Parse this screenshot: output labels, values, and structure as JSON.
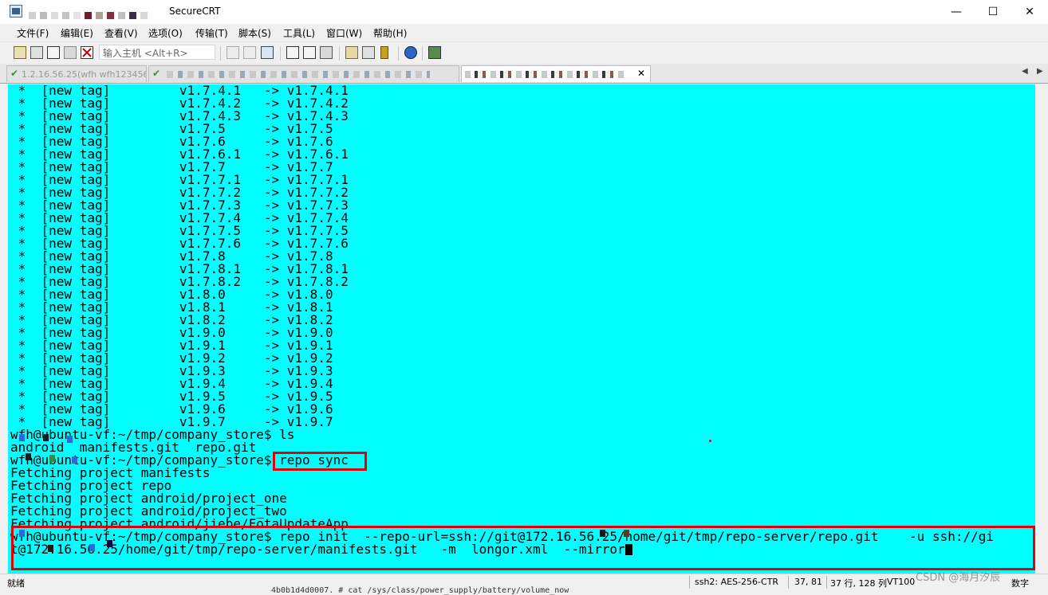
{
  "window": {
    "title": "SecureCRT",
    "minimize": "—",
    "maximize": "☐",
    "close": "✕"
  },
  "menu": [
    "文件(F)",
    "编辑(E)",
    "查看(V)",
    "选项(O)",
    "传输(T)",
    "脚本(S)",
    "工具(L)",
    "窗口(W)",
    "帮助(H)"
  ],
  "toolbar": {
    "host_placeholder": "输入主机 <Alt+R>"
  },
  "tabs": [
    {
      "label": "1.2.16.56.25(wfh wfh123456)",
      "active": false
    },
    {
      "label": "",
      "active": false
    },
    {
      "label": "",
      "active": true,
      "close": "✕"
    }
  ],
  "tab_scroll": {
    "left": "◀",
    "right": "▶"
  },
  "terminal": {
    "lines": [
      " *  [new tag]         v1.7.4.1   -> v1.7.4.1",
      " *  [new tag]         v1.7.4.2   -> v1.7.4.2",
      " *  [new tag]         v1.7.4.3   -> v1.7.4.3",
      " *  [new tag]         v1.7.5     -> v1.7.5",
      " *  [new tag]         v1.7.6     -> v1.7.6",
      " *  [new tag]         v1.7.6.1   -> v1.7.6.1",
      " *  [new tag]         v1.7.7     -> v1.7.7",
      " *  [new tag]         v1.7.7.1   -> v1.7.7.1",
      " *  [new tag]         v1.7.7.2   -> v1.7.7.2",
      " *  [new tag]         v1.7.7.3   -> v1.7.7.3",
      " *  [new tag]         v1.7.7.4   -> v1.7.7.4",
      " *  [new tag]         v1.7.7.5   -> v1.7.7.5",
      " *  [new tag]         v1.7.7.6   -> v1.7.7.6",
      " *  [new tag]         v1.7.8     -> v1.7.8",
      " *  [new tag]         v1.7.8.1   -> v1.7.8.1",
      " *  [new tag]         v1.7.8.2   -> v1.7.8.2",
      " *  [new tag]         v1.8.0     -> v1.8.0",
      " *  [new tag]         v1.8.1     -> v1.8.1",
      " *  [new tag]         v1.8.2     -> v1.8.2",
      " *  [new tag]         v1.9.0     -> v1.9.0",
      " *  [new tag]         v1.9.1     -> v1.9.1",
      " *  [new tag]         v1.9.2     -> v1.9.2",
      " *  [new tag]         v1.9.3     -> v1.9.3",
      " *  [new tag]         v1.9.4     -> v1.9.4",
      " *  [new tag]         v1.9.5     -> v1.9.5",
      " *  [new tag]         v1.9.6     -> v1.9.6",
      " *  [new tag]         v1.9.7     -> v1.9.7",
      "wfh@ubuntu-vf:~/tmp/company_store$ ls",
      "android  manifests.git  repo.git",
      "wfh@ubuntu-vf:~/tmp/company_store$ repo sync",
      "Fetching project manifests",
      "Fetching project repo",
      "Fetching project android/project_one",
      "Fetching project android/project_two",
      "Fetching project android/jiebe/FotaUpdateApp",
      "wfh@ubuntu-vf:~/tmp/company_store$ repo init  --repo-url=ssh://git@172.16.56.25/home/git/tmp/repo-server/repo.git    -u ssh://gi",
      "t@172.16.56.25/home/git/tmp/repo-server/manifests.git   -m  longor.xml  --mirror"
    ]
  },
  "statusbar": {
    "ready": "就绪",
    "cipher": "ssh2: AES-256-CTR",
    "cursor_pos": "37,  81",
    "size": "37 行, 128 列",
    "emulation": "VT100",
    "numlock": "数字"
  },
  "watermark": "CSDN @海月汐辰",
  "under_text": "4b0b1d4d0007. # cat /sys/class/power_supply/battery/volume_now",
  "colors": {
    "terminal_bg": "#00ffff",
    "highlight": "#e0000a"
  }
}
